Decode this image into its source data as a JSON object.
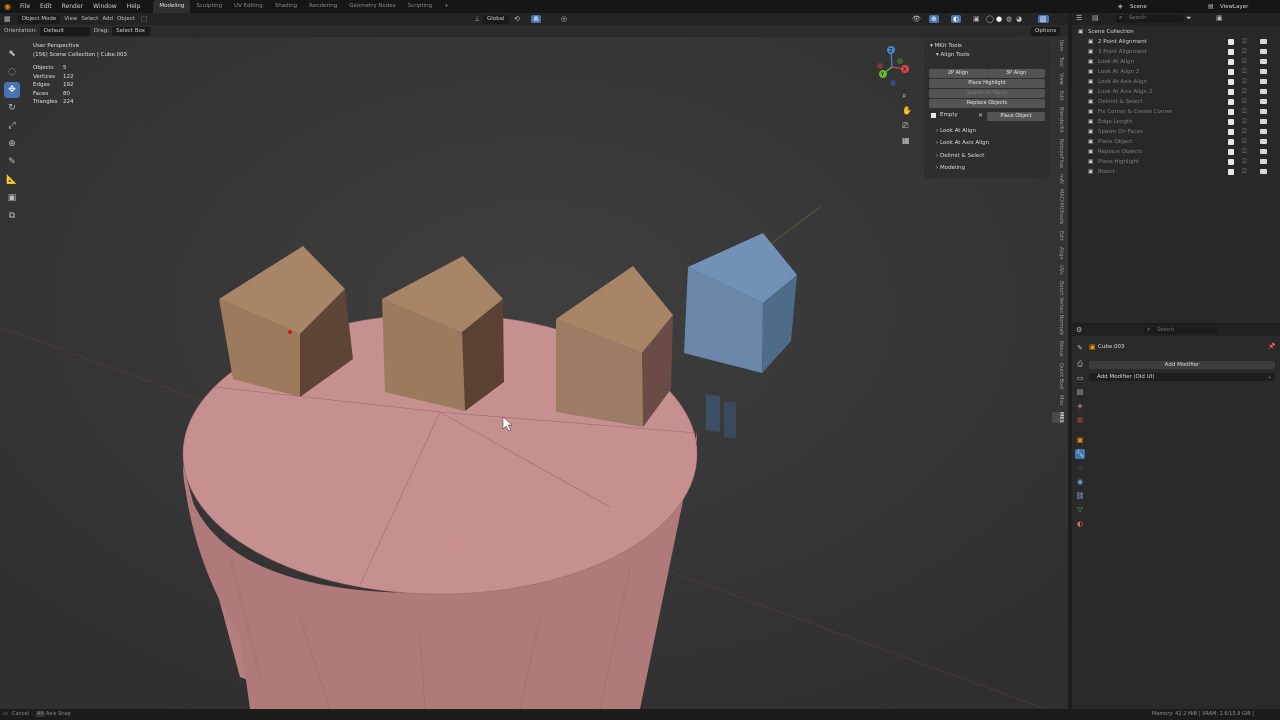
{
  "menus": [
    "File",
    "Edit",
    "Render",
    "Window",
    "Help"
  ],
  "workspaces": [
    "Modeling",
    "Sculpting",
    "UV Editing",
    "Shading",
    "Rendering",
    "Geometry Nodes",
    "Scripting"
  ],
  "active_workspace": "Modeling",
  "scene_name": "Scene",
  "view_layer": "ViewLayer",
  "header": {
    "mode": "Object Mode",
    "view": "View",
    "select": "Select",
    "add": "Add",
    "object": "Object",
    "transform_space": "Global"
  },
  "tool_header": {
    "orientation_label": "Orientation:",
    "orientation_value": "Default",
    "drag_label": "Drag:",
    "drag_value": "Select Box",
    "options": "Options"
  },
  "viewport": {
    "view_name": "User Perspective",
    "context": "(156) Scene Collection | Cube.003",
    "stats": [
      {
        "label": "Objects",
        "value": "5"
      },
      {
        "label": "Vertices",
        "value": "122"
      },
      {
        "label": "Edges",
        "value": "192"
      },
      {
        "label": "Faces",
        "value": "80"
      },
      {
        "label": "Triangles",
        "value": "224"
      }
    ],
    "gizmo": {
      "x": "X",
      "y": "Y",
      "z": "Z"
    }
  },
  "npanel": {
    "title": "MKit Tools",
    "section": "Align Tools",
    "btn_2p": "2P Align",
    "btn_3p": "3P Align",
    "place_highlight": "Place Highlight",
    "spawn_on_faces": "Spawn on Faces",
    "replace_objects": "Replace Objects",
    "empty_label": "Empty",
    "place_object": "Place Object",
    "collapsed": [
      "Look At Align",
      "Look At Axis Align",
      "Delimit & Select",
      "Modeling"
    ]
  },
  "sidebar_tabs": [
    "Item",
    "Tool",
    "View",
    "Edit",
    "BlenderKit",
    "RetopoFlow",
    "mAI",
    "MACHIN3tools",
    "Edit",
    "Align",
    "UVs",
    "Batch Vertex Normals",
    "Nexus",
    "Quick Bool",
    "Misc",
    "MKit"
  ],
  "outliner": {
    "search_placeholder": "Search",
    "root": "Scene Collection",
    "items": [
      {
        "name": "2 Point Alignment",
        "dim": false
      },
      {
        "name": "3 Point Alignment",
        "dim": true
      },
      {
        "name": "Look At Align",
        "dim": true
      },
      {
        "name": "Look At Align 2",
        "dim": true
      },
      {
        "name": "Look At Axis Align",
        "dim": true
      },
      {
        "name": "Look At Axis Align 2",
        "dim": true
      },
      {
        "name": "Delimit & Select",
        "dim": true
      },
      {
        "name": "Fix Corner & Create Corner",
        "dim": true
      },
      {
        "name": "Edge Length",
        "dim": true
      },
      {
        "name": "Spawn On Faces",
        "dim": true
      },
      {
        "name": "Place Object",
        "dim": true
      },
      {
        "name": "Replace Objects",
        "dim": true
      },
      {
        "name": "Place Highlight",
        "dim": true
      },
      {
        "name": "Bisect",
        "dim": true
      }
    ]
  },
  "properties": {
    "search_placeholder": "Search",
    "object_name": "Cube.003",
    "add_modifier": "Add Modifier",
    "add_modifier_old": "Add Modifier (Old UI)"
  },
  "statusbar": {
    "left": "Cancel",
    "left2": "Alt",
    "left3": "Axis Snap",
    "right": "Memory: 42.2 MiB | VRAM: 2.6/15.9 GiB |"
  },
  "colors": {
    "accent": "#4772b3",
    "cylinder": "#c08b8b",
    "house": "#a08068",
    "selected_house": "#6f8fb6"
  }
}
